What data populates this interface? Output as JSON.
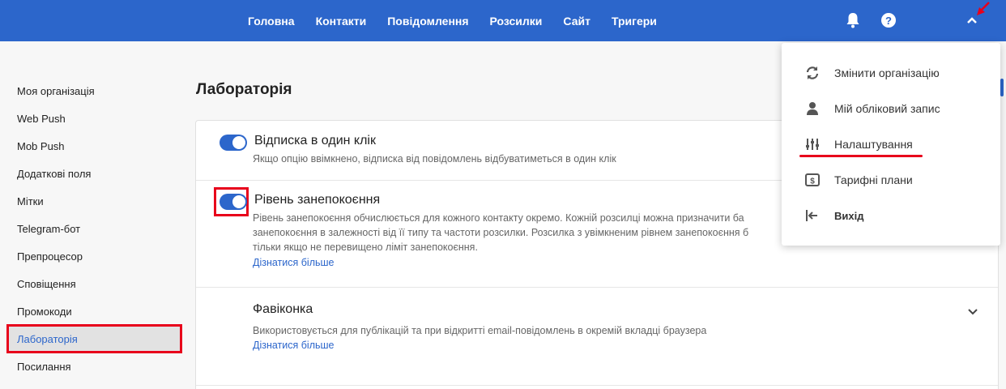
{
  "nav": {
    "items": [
      {
        "label": "Головна"
      },
      {
        "label": "Контакти"
      },
      {
        "label": "Повідомлення"
      },
      {
        "label": "Розсилки"
      },
      {
        "label": "Сайт"
      },
      {
        "label": "Тригери"
      }
    ],
    "icons": [
      "bell-icon",
      "help-icon",
      "chevron-up-icon"
    ],
    "help_glyph": "?"
  },
  "sidebar": {
    "items": [
      {
        "label": "Моя організація"
      },
      {
        "label": "Web Push"
      },
      {
        "label": "Mob Push"
      },
      {
        "label": "Додаткові поля"
      },
      {
        "label": "Мітки"
      },
      {
        "label": "Telegram-бот"
      },
      {
        "label": "Препроцесор"
      },
      {
        "label": "Сповіщення"
      },
      {
        "label": "Промокоди"
      },
      {
        "label": "Лабораторія",
        "active": true
      },
      {
        "label": "Посилання"
      }
    ]
  },
  "page": {
    "title": "Лабораторія"
  },
  "settings": [
    {
      "title": "Відписка в один клік",
      "enabled": true,
      "desc_lines": [
        "Якщо опцію ввімкнено, відписка від повідомлень відбуватиметься в один клік"
      ]
    },
    {
      "title": "Рівень занепокоєння",
      "enabled": true,
      "desc_lines": [
        "Рівень занепокоєння обчислюється для кожного контакту окремо. Кожній розсилці можна призначити ба",
        "занепокоєння в залежності від її типу та частоти розсилки. Розсилка з увімкненим рівнем занепокоєння б",
        "тільки якщо не перевищено ліміт занепокоєння."
      ],
      "link": "Дізнатися більше"
    },
    {
      "title": "Фавіконка",
      "desc_lines": [
        "Використовується для публікацій та при відкритті email-повідомлень в окремій вкладці браузера"
      ],
      "link": "Дізнатися більше"
    }
  ],
  "dropdown": {
    "items": [
      {
        "label": "Змінити організацію",
        "icon": "refresh-icon"
      },
      {
        "label": "Мій обліковий запис",
        "icon": "user-icon"
      },
      {
        "label": "Налаштування",
        "icon": "sliders-icon"
      },
      {
        "label": "Тарифні плани",
        "icon": "pricing-icon"
      },
      {
        "label": "Вихід",
        "icon": "logout-icon"
      }
    ]
  },
  "colors": {
    "accent": "#2c66cb",
    "highlight": "#e8001b",
    "background": "#f7f7f7"
  }
}
